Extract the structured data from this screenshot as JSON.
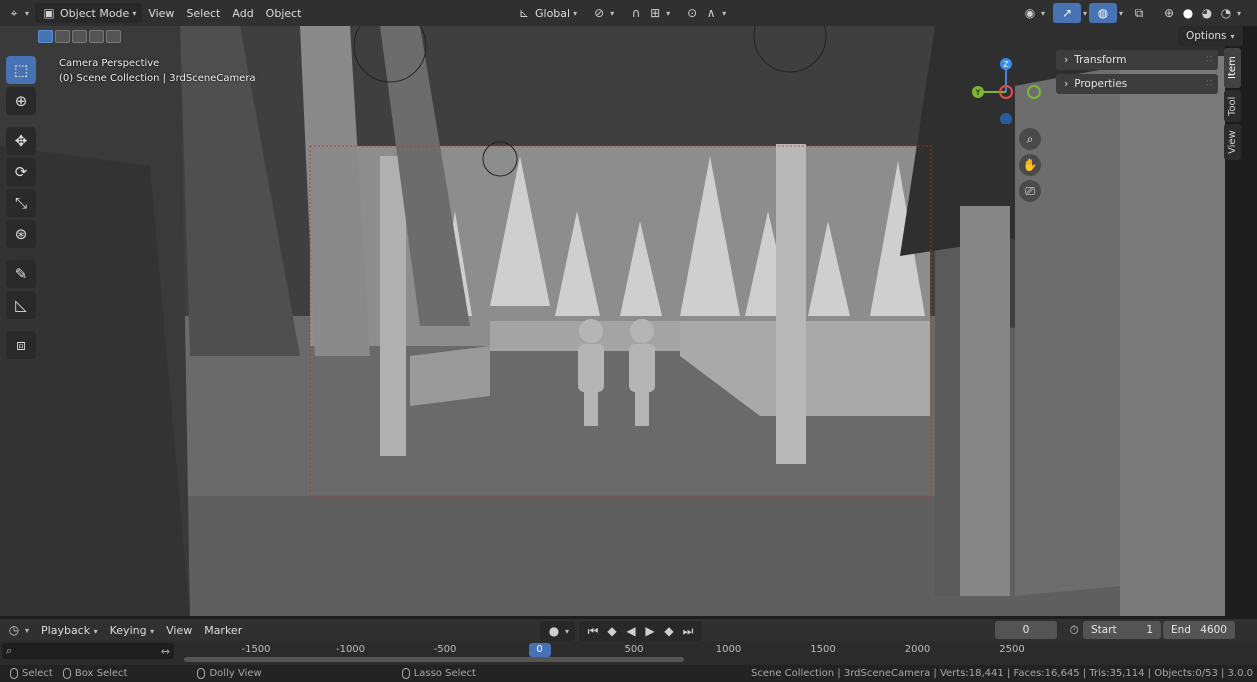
{
  "header": {
    "mode": "Object Mode",
    "menus": [
      "View",
      "Select",
      "Add",
      "Object"
    ],
    "transform_orientation": "Global",
    "options_label": "Options"
  },
  "viewport": {
    "info_line1": "Camera Perspective",
    "info_line2": "(0) Scene Collection | 3rdSceneCamera",
    "gizmo_axes": {
      "x": "X",
      "y": "Y",
      "z": "Z"
    },
    "colors": {
      "x_axis": "#e34c4c",
      "y_axis": "#7fb733",
      "z_axis": "#3b8ae6",
      "active_tool": "#4772b3"
    }
  },
  "toolbar": {
    "tools": [
      "select-box-icon",
      "cursor-icon",
      "move-icon",
      "rotate-icon",
      "scale-icon",
      "transform-icon",
      "annotate-icon",
      "measure-icon",
      "add-cube-icon"
    ]
  },
  "npanel": {
    "sections": [
      "Transform",
      "Properties"
    ],
    "tabs": [
      "Item",
      "Tool",
      "View"
    ]
  },
  "timeline": {
    "menus": [
      "Playback",
      "Keying",
      "View",
      "Marker"
    ],
    "current_frame": "0",
    "start_label": "Start",
    "start_value": "1",
    "end_label": "End",
    "end_value": "4600",
    "ruler_labels": [
      "-1500",
      "-1000",
      "-500",
      "0",
      "500",
      "1000",
      "1500",
      "2000",
      "2500"
    ],
    "search_placeholder": ""
  },
  "statusbar": {
    "select": "Select",
    "box_select": "Box Select",
    "dolly_view": "Dolly View",
    "lasso_select": "Lasso Select",
    "scene_info": "Scene Collection | 3rdSceneCamera | Verts:18,441 | Faces:16,645 | Tris:35,114 | Objects:0/53 | 3.0.0"
  }
}
